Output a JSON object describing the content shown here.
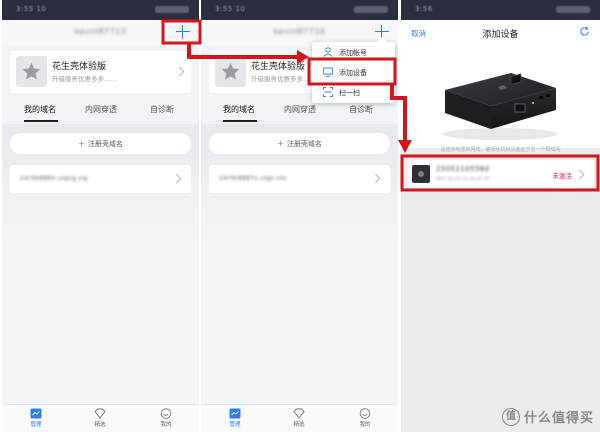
{
  "screens": [
    {
      "title": "",
      "version_card": {
        "title": "花生壳体验版",
        "subtitle": "升级服务优惠多多......"
      },
      "tabs": [
        "我的域名",
        "内网穿透",
        "自诊断"
      ],
      "register_button": "注册壳域名",
      "bottom_nav": [
        "管理",
        "精选",
        "我的"
      ]
    },
    {
      "title": "",
      "version_card": {
        "title": "花生壳体验版",
        "subtitle": "升级服务优惠多多..."
      },
      "tabs": [
        "我的域名",
        "内网穿透",
        "自诊断"
      ],
      "register_button": "注册壳域名",
      "popup_menu": [
        "添加帐号",
        "添加设备",
        "扫一扫"
      ],
      "bottom_nav": [
        "管理",
        "精选",
        "我的"
      ]
    },
    {
      "header": {
        "cancel": "取消",
        "title": "添加设备"
      },
      "hint": "请连接电源和网线，确保手机和设备在于同一个局域网",
      "device": {
        "status": "未激活"
      }
    }
  ],
  "watermark": {
    "logo": "值",
    "text": "什么值得买"
  },
  "colors": {
    "accent": "#2f7cf0",
    "annotation": "#d5151c",
    "inactive": "#e0274a"
  }
}
